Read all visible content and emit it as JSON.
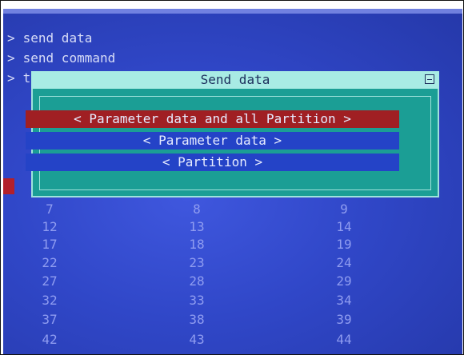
{
  "menu": {
    "items": [
      {
        "arrow": ">",
        "text": "send data"
      },
      {
        "arrow": ">",
        "text": "send command"
      },
      {
        "arrow": ">",
        "text": "to"
      }
    ]
  },
  "dialog": {
    "title": "Send data",
    "options": [
      "< Parameter data and all Partition >",
      "< Parameter data >",
      "< Partition >"
    ]
  },
  "grid": {
    "rows": [
      [
        "7",
        "8",
        "9"
      ],
      [
        "12",
        "13",
        "14"
      ],
      [
        "17",
        "18",
        "19"
      ],
      [
        "22",
        "23",
        "24"
      ],
      [
        "27",
        "28",
        "29"
      ],
      [
        "32",
        "33",
        "34"
      ],
      [
        "37",
        "38",
        "39"
      ],
      [
        "42",
        "43",
        "44"
      ]
    ]
  },
  "colors": {
    "background": "#3047c8",
    "dialog_bg": "#1b9e95",
    "dialog_title_bg": "#a8ebe4",
    "selected_option": "#a01f23",
    "option": "#2443c7"
  }
}
